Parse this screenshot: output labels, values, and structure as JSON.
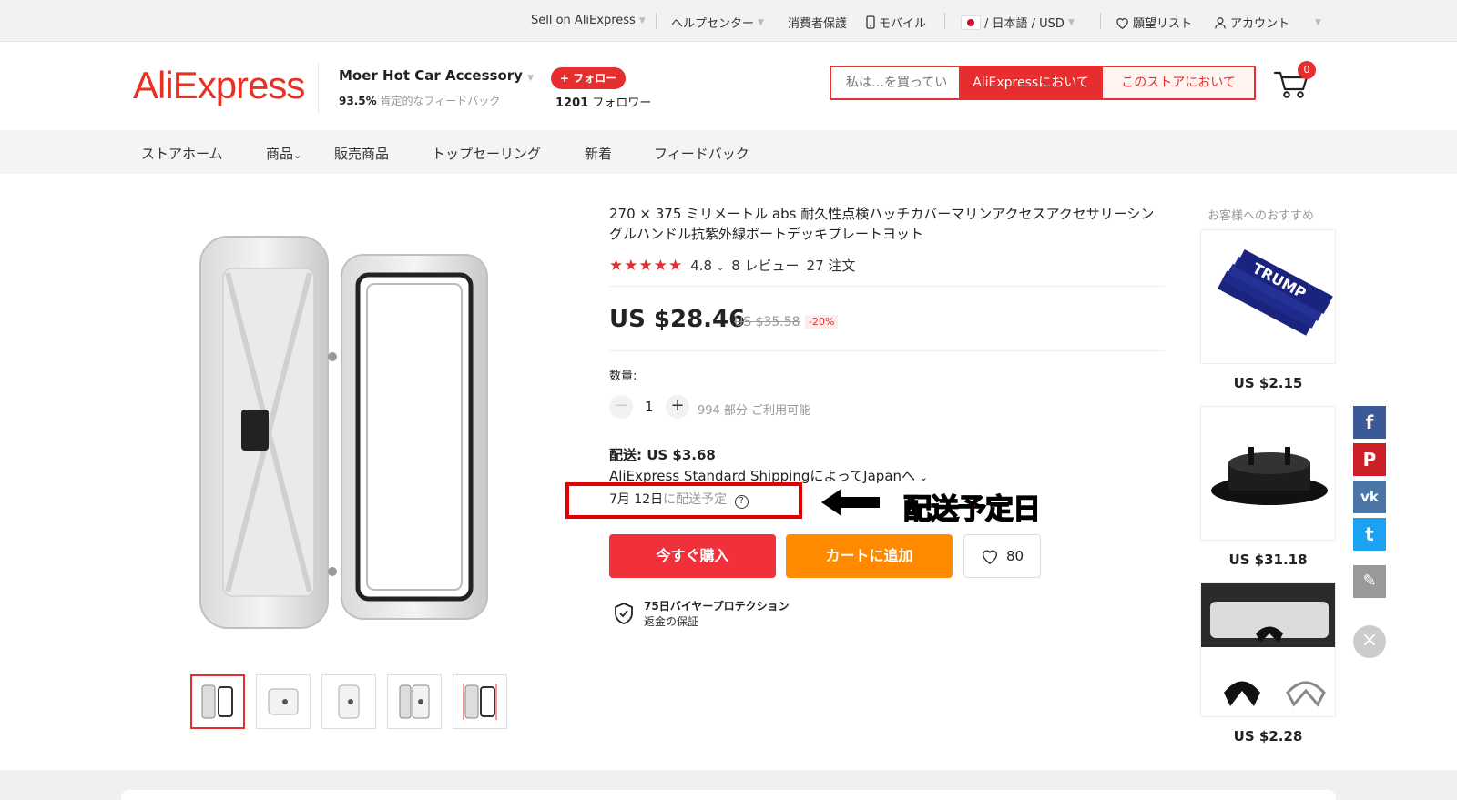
{
  "topbar": {
    "sell": "Sell on AliExpress",
    "help": "ヘルプセンター",
    "buyer_protection": "消費者保護",
    "mobile": "モバイル",
    "locale": "/ 日本語 /  USD",
    "wishlist": "願望リスト",
    "account": "アカウント"
  },
  "header": {
    "logo": "AliExpress",
    "store_name": "Moer Hot Car Accessory",
    "feedback_pct": "93.5%",
    "feedback_label": "肯定的なフィードバック",
    "follow_label": "+ フォロー",
    "followers_count": "1201",
    "followers_label": "フォロワー",
    "search_placeholder": "私は…を買ってい",
    "search_all": "AliExpressにおいて",
    "search_store": "このストアにおいて",
    "cart_count": "0"
  },
  "nav": {
    "items": [
      "ストアホーム",
      "商品",
      "販売商品",
      "トップセーリング",
      "新着",
      "フィードバック"
    ]
  },
  "product": {
    "title": "270 × 375 ミリメートル abs 耐久性点検ハッチカバーマリンアクセスアクセサリーシングルハンドル抗紫外線ボートデッキプレートヨット",
    "stars": "★★★★★",
    "rating": "4.8",
    "reviews": "8 レビュー",
    "orders": "27 注文",
    "price": "US $28.46",
    "old_price": "US $35.58",
    "discount": "-20%",
    "qty_label": "数量:",
    "qty_value": "1",
    "qty_available": "994 部分 ご利用可能",
    "shipping": "配送: US $3.68",
    "shipping_method": "AliExpress Standard ShippingによってJapanへ",
    "delivery_date": "7月 12日",
    "delivery_suffix": "に配送予定",
    "annotation": "配送予定日",
    "buy_now": "今すぐ購入",
    "add_to_cart": "カートに追加",
    "wish_count": "80",
    "protection_title": "75日バイヤープロテクション",
    "protection_sub": "返金の保証"
  },
  "recommendations": {
    "title": "お客様へのおすすめ",
    "items": [
      {
        "price": "US $2.15",
        "image_text": "TRUMP"
      },
      {
        "price": "US $31.18"
      },
      {
        "price": "US $2.28"
      }
    ]
  },
  "social": {
    "facebook": "f",
    "pinterest": "P",
    "vk": "vk",
    "twitter": "t"
  },
  "colors": {
    "brand_red": "#e62e2e",
    "orange": "#ff8a00",
    "annotation_red": "#e50000"
  }
}
